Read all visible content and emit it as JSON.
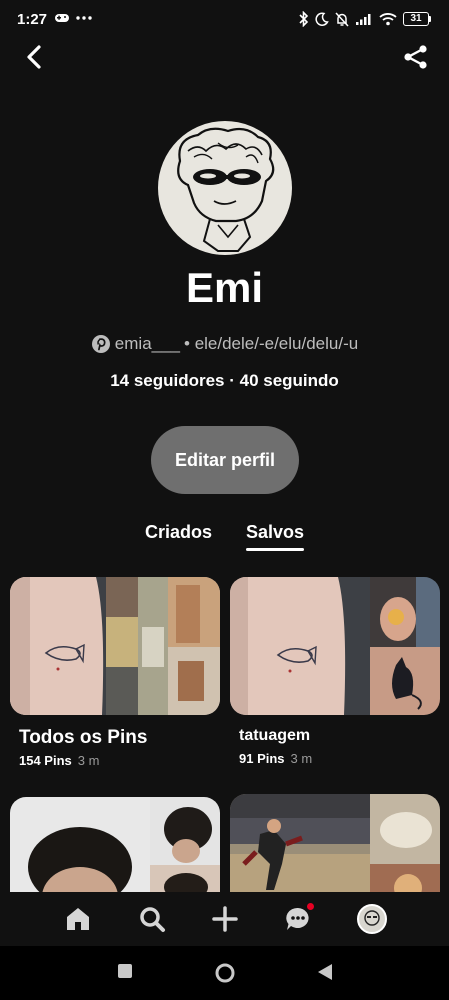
{
  "status_bar": {
    "time": "1:27",
    "battery": "31"
  },
  "profile": {
    "name": "Emi",
    "handle": "emia___",
    "pronouns": "• ele/dele/-e/elu/delu/-u",
    "followers_following": "14 seguidores · 40 seguindo",
    "edit_button": "Editar perfil"
  },
  "tabs": [
    {
      "label": "Criados",
      "active": false
    },
    {
      "label": "Salvos",
      "active": true
    }
  ],
  "boards": [
    {
      "title": "Todos os Pins",
      "pins": "154 Pins",
      "age": "3 m"
    },
    {
      "title": "tatuagem",
      "pins": "91 Pins",
      "age": "3 m"
    }
  ],
  "bottom_nav": [
    "home-icon",
    "search-icon",
    "plus-icon",
    "messages-icon",
    "profile-avatar"
  ],
  "colors": {
    "background": "#111111",
    "button": "#6f6f6f",
    "accent": "#e60023"
  }
}
